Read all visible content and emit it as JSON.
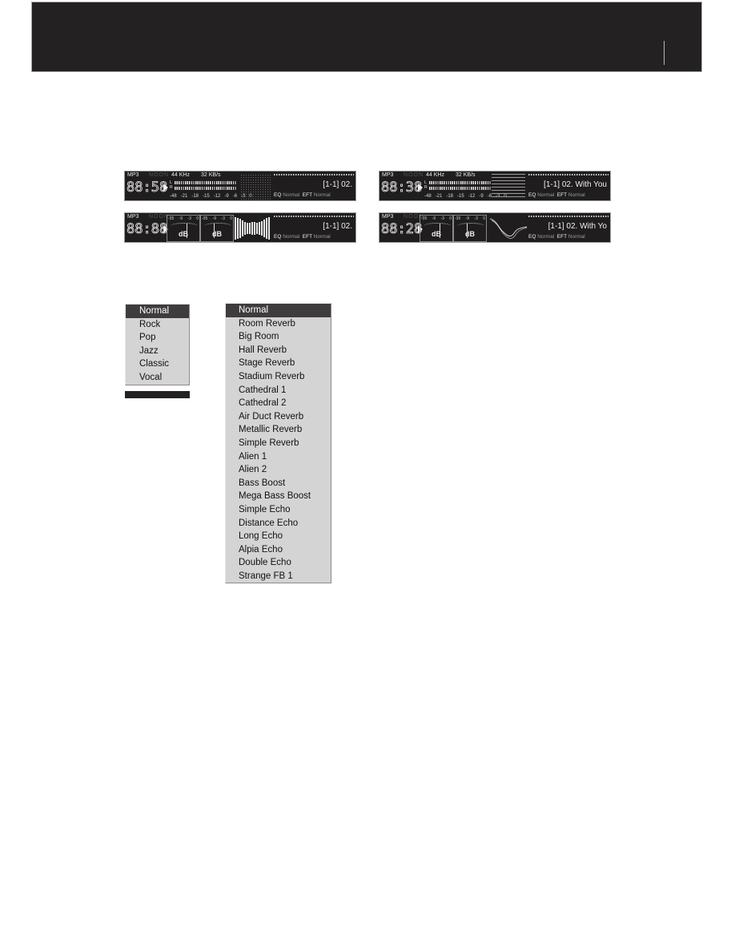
{
  "header": {
    "title": ""
  },
  "players": [
    {
      "id": "spectrum-dots",
      "codec": "MP3",
      "mode": "NOON",
      "time": "88:58",
      "sample_rate": "44 KHz",
      "bitrate": "32 KB/s",
      "channels": [
        "L",
        "R"
      ],
      "scale": [
        "-48",
        "-21",
        "-18",
        "-15",
        "-12",
        "-9",
        "-6",
        "-3",
        "0"
      ],
      "visual": "dot-spectrum",
      "track": "[1-1] 02.",
      "eq_label": "EQ",
      "eq_value": "Normal",
      "eft_label": "EFT",
      "eft_value": "Normal"
    },
    {
      "id": "spectrum-bars",
      "codec": "MP3",
      "mode": "NOON",
      "time": "88:38",
      "sample_rate": "44 KHz",
      "bitrate": "32 KB/s",
      "channels": [
        "L",
        "R"
      ],
      "scale": [
        "-48",
        "-21",
        "-18",
        "-15",
        "-12",
        "-9",
        "-6",
        "-3",
        "0"
      ],
      "visual": "bar-spectrum",
      "track": "[1-1] 02. With You",
      "eq_label": "EQ",
      "eq_value": "Normal",
      "eft_label": "EFT",
      "eft_value": "Normal"
    },
    {
      "id": "db-waveform",
      "codec": "MP3",
      "mode": "NOON",
      "time": "88:88",
      "db_scale": [
        "-35",
        "-9",
        "-3",
        "0"
      ],
      "db_label": "dB",
      "visual": "waveform",
      "track": "[1-1] 02.",
      "eq_label": "EQ",
      "eq_value": "Normal",
      "eft_label": "EFT",
      "eft_value": "Normal"
    },
    {
      "id": "db-oscilloscope",
      "codec": "MP3",
      "mode": "NOON",
      "time": "88:28",
      "db_scale": [
        "-35",
        "-9",
        "-3",
        "0"
      ],
      "db_label": "dB",
      "visual": "oscilloscope",
      "track": "[1-1] 02. With Yo",
      "eq_label": "EQ",
      "eq_value": "Normal",
      "eft_label": "EFT",
      "eft_value": "Normal"
    }
  ],
  "eq_menu": {
    "selected": "Normal",
    "items": [
      "Normal",
      "Rock",
      "Pop",
      "Jazz",
      "Classic",
      "Vocal"
    ]
  },
  "eft_menu": {
    "selected": "Normal",
    "items": [
      "Normal",
      "Room Reverb",
      "Big Room",
      "Hall Reverb",
      "Stage Reverb",
      "Stadium Reverb",
      "Cathedral 1",
      "Cathedral 2",
      "Air Duct Reverb",
      "Metallic Reverb",
      "Simple Reverb",
      "Alien 1",
      "Alien 2",
      "Bass Boost",
      "Mega Bass Boost",
      "Simple Echo",
      "Distance Echo",
      "Long Echo",
      "Alpia Echo",
      "Double Echo",
      "Strange FB 1"
    ]
  },
  "colors": {
    "header_bg": "#242122",
    "player_bg": "#1f1d1e",
    "menu_bg": "#d4d4d4",
    "menu_selected_bg": "#3f3c3d"
  }
}
